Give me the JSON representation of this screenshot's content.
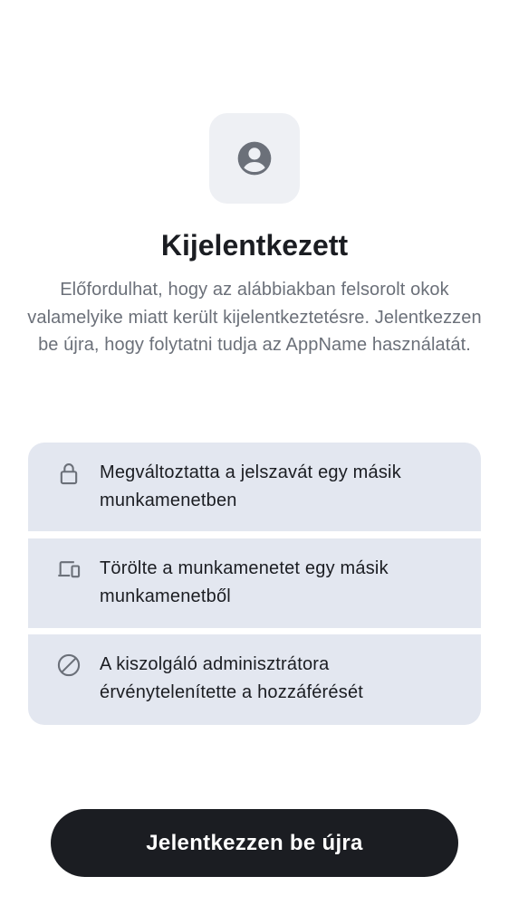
{
  "header": {
    "avatar_icon": "user-circle-icon",
    "title": "Kijelentkezett",
    "subtitle": "Előfordulhat, hogy az alábbiakban felsorolt okok valamelyike miatt került kijelentkeztetésre. Jelentkezzen be újra, hogy folytatni tudja az AppName használatát."
  },
  "reasons": [
    {
      "icon": "lock-icon",
      "text": "Megváltoztatta a jelszavát egy másik munkamenetben"
    },
    {
      "icon": "devices-icon",
      "text": "Törölte a munkamenetet egy másik munkamenetből"
    },
    {
      "icon": "block-icon",
      "text": "A kiszolgáló adminisztrátora érvénytelenítette a hozzáférését"
    }
  ],
  "actions": {
    "sign_in_again_label": "Jelentkezzen be újra"
  },
  "colors": {
    "background": "#ffffff",
    "avatar_bg": "#eef0f4",
    "icon": "#6b7079",
    "reason_bg": "#e3e7f0",
    "text_primary": "#1b1d22",
    "text_secondary": "#6b7079",
    "button_bg": "#1b1d22",
    "button_text": "#ffffff"
  }
}
